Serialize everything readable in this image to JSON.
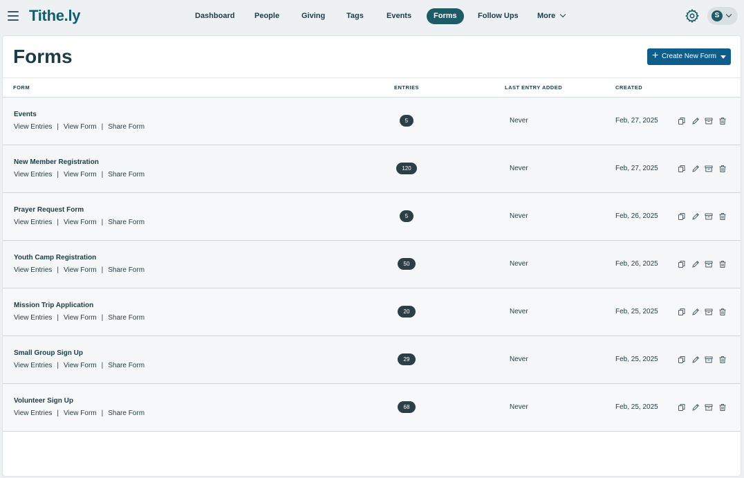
{
  "brand": {
    "logo_text": "Tithe.ly",
    "accent": "#1e5b66",
    "button_color": "#0f5d8a"
  },
  "nav": {
    "menu_icon": "hamburger-icon",
    "items": [
      {
        "label": "Dashboard"
      },
      {
        "label": "People"
      },
      {
        "label": "Giving"
      },
      {
        "label": "Tags"
      },
      {
        "label": "Events"
      },
      {
        "label": "Forms",
        "active": true
      },
      {
        "label": "Follow Ups"
      },
      {
        "label": "More",
        "has_dropdown": true
      }
    ],
    "settings_icon": "gear-icon",
    "user_initial": "S"
  },
  "page": {
    "title": "Forms",
    "create_button": "Create New Form"
  },
  "table": {
    "headers": {
      "form": "FORM",
      "entries": "ENTRIES",
      "last_entry": "LAST ENTRY ADDED",
      "created": "CREATED"
    },
    "link_labels": {
      "view_entries": "View Entries",
      "view_form": "View Form",
      "share_form": "Share Form",
      "separator": "|"
    },
    "action_icons": [
      "copy-icon",
      "edit-icon",
      "archive-icon",
      "delete-icon"
    ],
    "rows": [
      {
        "name": "Events",
        "entries": "5",
        "last_entry": "Never",
        "created": "Feb, 27, 2025"
      },
      {
        "name": "New Member Registration",
        "entries": "120",
        "last_entry": "Never",
        "created": "Feb, 27, 2025"
      },
      {
        "name": "Prayer Request Form",
        "entries": "5",
        "last_entry": "Never",
        "created": "Feb, 26, 2025"
      },
      {
        "name": "Youth Camp Registration",
        "entries": "50",
        "last_entry": "Never",
        "created": "Feb, 26, 2025"
      },
      {
        "name": "Mission Trip Application",
        "entries": "20",
        "last_entry": "Never",
        "created": "Feb, 25, 2025"
      },
      {
        "name": "Small Group Sign Up",
        "entries": "29",
        "last_entry": "Never",
        "created": "Feb, 25, 2025"
      },
      {
        "name": "Volunteer Sign Up",
        "entries": "68",
        "last_entry": "Never",
        "created": "Feb, 25, 2025"
      }
    ]
  }
}
